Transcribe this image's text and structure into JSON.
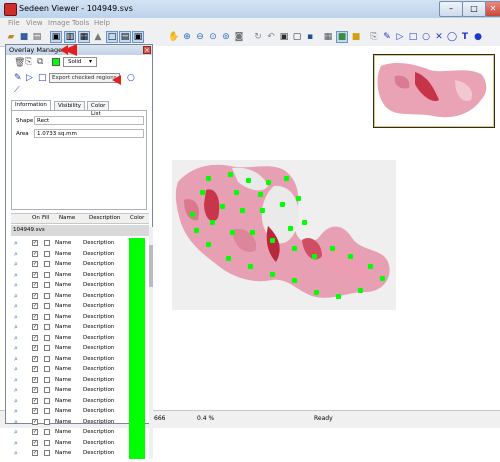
{
  "window": {
    "title": "Sedeen Viewer - 104949.svs"
  },
  "menu": [
    "File",
    "View",
    "Image",
    "Tools",
    "Help"
  ],
  "window_controls": {
    "minimize": "–",
    "maximize": "□",
    "close": "✕"
  },
  "overlay_manager": {
    "title": "Overlay Manager",
    "close": "×",
    "style_label": "Solid",
    "tooltip": "Export checked regions",
    "tabs": [
      "Information",
      "Visibility",
      "Color List"
    ],
    "info": {
      "shape_label": "Shape",
      "shape_value": "Rect",
      "area_label": "Area",
      "area_value": "1.0733 sq.mm"
    },
    "table": {
      "headers": [
        "On",
        "Fill",
        "Name",
        "Description",
        "Color"
      ],
      "group": "104949.svs",
      "row_name": "Name",
      "row_description": "Description",
      "row_color": "#00ff00",
      "row_count": 21
    }
  },
  "status": {
    "left": "666",
    "zoom": "0.4 %",
    "state": "Ready"
  },
  "colors": {
    "accent": "#cc2d2d",
    "marker": "#e21e1e",
    "region": "#00ff00"
  }
}
